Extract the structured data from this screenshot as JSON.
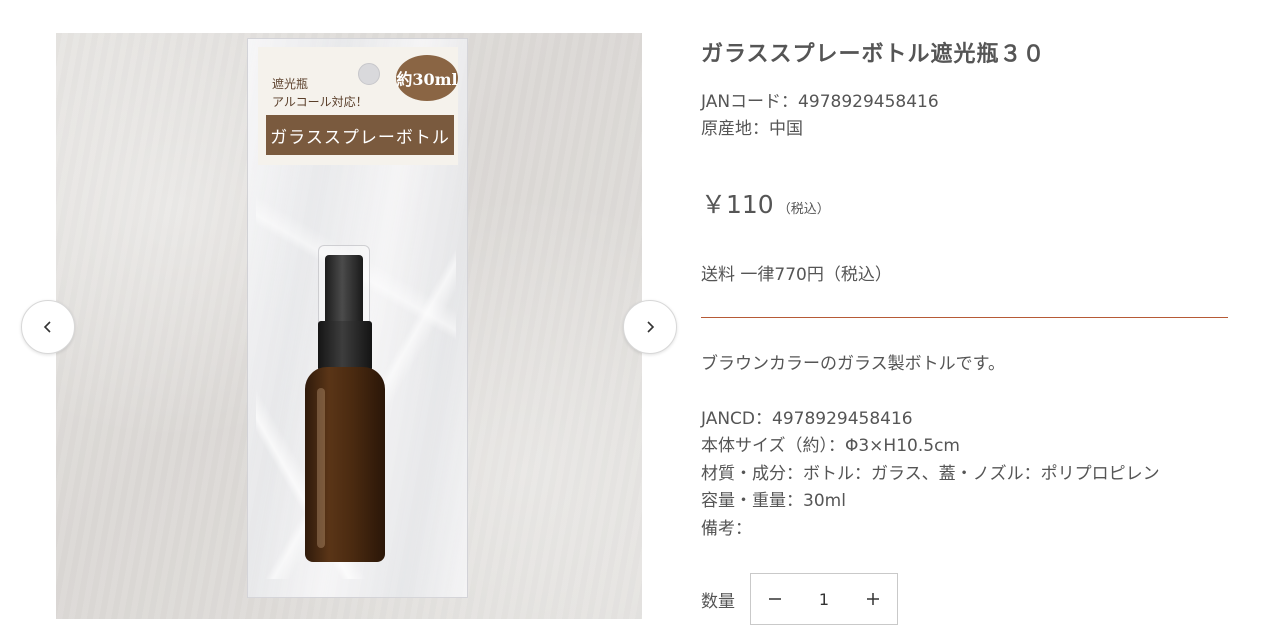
{
  "gallery": {
    "product_photo": {
      "package_text": [
        "遮光瓶",
        "アルコール対応！"
      ],
      "size_badge": "約30ml",
      "package_name": "ガラススプレーボトル"
    },
    "prev_icon": "chevron-left-icon",
    "next_icon": "chevron-right-icon"
  },
  "product": {
    "title": "ガラススプレーボトル遮光瓶３０",
    "jan_code": "JANコード：4978929458416",
    "origin": "原産地：中国",
    "price": "￥110",
    "tax_note": "（税込）",
    "shipping": "送料 一律770円（税込）",
    "description": [
      "ブラウンカラーのガラス製ボトルです。",
      "",
      "JANCD：4978929458416",
      "本体サイズ（約）：Φ3×H10.5cm",
      "材質・成分：ボトル：ガラス、蓋・ノズル：ポリプロピレン",
      "容量・重量：30ml",
      "備考："
    ]
  },
  "quantity": {
    "label": "数量",
    "value": "1",
    "minus_icon": "minus-icon",
    "plus_icon": "plus-icon"
  },
  "colors": {
    "divider": "#b65a36",
    "text": "#555555"
  }
}
